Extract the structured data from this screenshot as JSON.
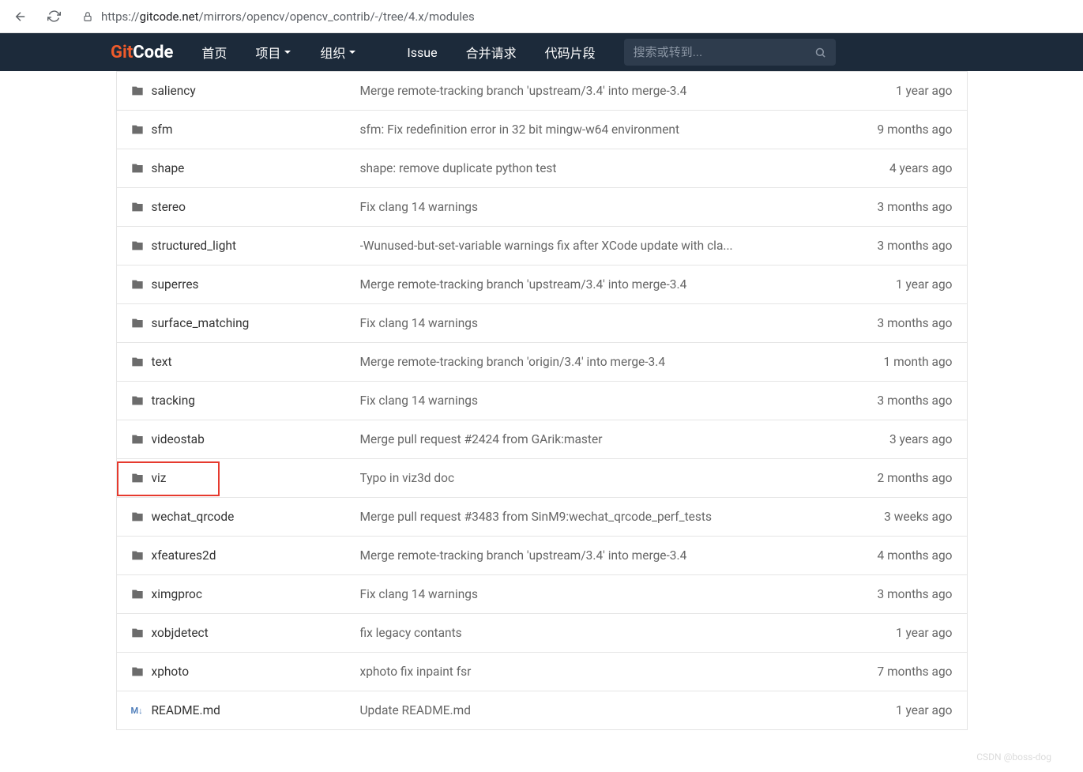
{
  "browser": {
    "url_prefix": "https://",
    "url_domain": "gitcode.net",
    "url_path": "/mirrors/opencv/opencv_contrib/-/tree/4.x/modules"
  },
  "nav": {
    "logo_git": "Git",
    "logo_code": "Code",
    "home": "首页",
    "projects": "项目",
    "orgs": "组织",
    "issue": "Issue",
    "merge": "合并请求",
    "snippets": "代码片段",
    "search_placeholder": "搜索或转到..."
  },
  "files": [
    {
      "type": "folder",
      "name": "saliency",
      "commit": "Merge remote-tracking branch 'upstream/3.4' into merge-3.4",
      "time": "1 year ago",
      "hl": false
    },
    {
      "type": "folder",
      "name": "sfm",
      "commit": "sfm: Fix redefinition error in 32 bit mingw-w64 environment",
      "time": "9 months ago",
      "hl": false
    },
    {
      "type": "folder",
      "name": "shape",
      "commit": "shape: remove duplicate python test",
      "time": "4 years ago",
      "hl": false
    },
    {
      "type": "folder",
      "name": "stereo",
      "commit": "Fix clang 14 warnings",
      "time": "3 months ago",
      "hl": false
    },
    {
      "type": "folder",
      "name": "structured_light",
      "commit": "-Wunused-but-set-variable warnings fix after XCode update with cla...",
      "time": "3 months ago",
      "hl": false
    },
    {
      "type": "folder",
      "name": "superres",
      "commit": "Merge remote-tracking branch 'upstream/3.4' into merge-3.4",
      "time": "1 year ago",
      "hl": false
    },
    {
      "type": "folder",
      "name": "surface_matching",
      "commit": "Fix clang 14 warnings",
      "time": "3 months ago",
      "hl": false
    },
    {
      "type": "folder",
      "name": "text",
      "commit": "Merge remote-tracking branch 'origin/3.4' into merge-3.4",
      "time": "1 month ago",
      "hl": false
    },
    {
      "type": "folder",
      "name": "tracking",
      "commit": "Fix clang 14 warnings",
      "time": "3 months ago",
      "hl": false
    },
    {
      "type": "folder",
      "name": "videostab",
      "commit": "Merge pull request #2424 from GArik:master",
      "time": "3 years ago",
      "hl": false
    },
    {
      "type": "folder",
      "name": "viz",
      "commit": "Typo in viz3d doc",
      "time": "2 months ago",
      "hl": true
    },
    {
      "type": "folder",
      "name": "wechat_qrcode",
      "commit": "Merge pull request #3483 from SinM9:wechat_qrcode_perf_tests",
      "time": "3 weeks ago",
      "hl": false
    },
    {
      "type": "folder",
      "name": "xfeatures2d",
      "commit": "Merge remote-tracking branch 'upstream/3.4' into merge-3.4",
      "time": "4 months ago",
      "hl": false
    },
    {
      "type": "folder",
      "name": "ximgproc",
      "commit": "Fix clang 14 warnings",
      "time": "3 months ago",
      "hl": false
    },
    {
      "type": "folder",
      "name": "xobjdetect",
      "commit": "fix legacy contants",
      "time": "1 year ago",
      "hl": false
    },
    {
      "type": "folder",
      "name": "xphoto",
      "commit": "xphoto fix inpaint fsr",
      "time": "7 months ago",
      "hl": false
    },
    {
      "type": "md",
      "name": "README.md",
      "commit": "Update README.md",
      "time": "1 year ago",
      "hl": false
    }
  ],
  "watermark": "CSDN @boss-dog"
}
